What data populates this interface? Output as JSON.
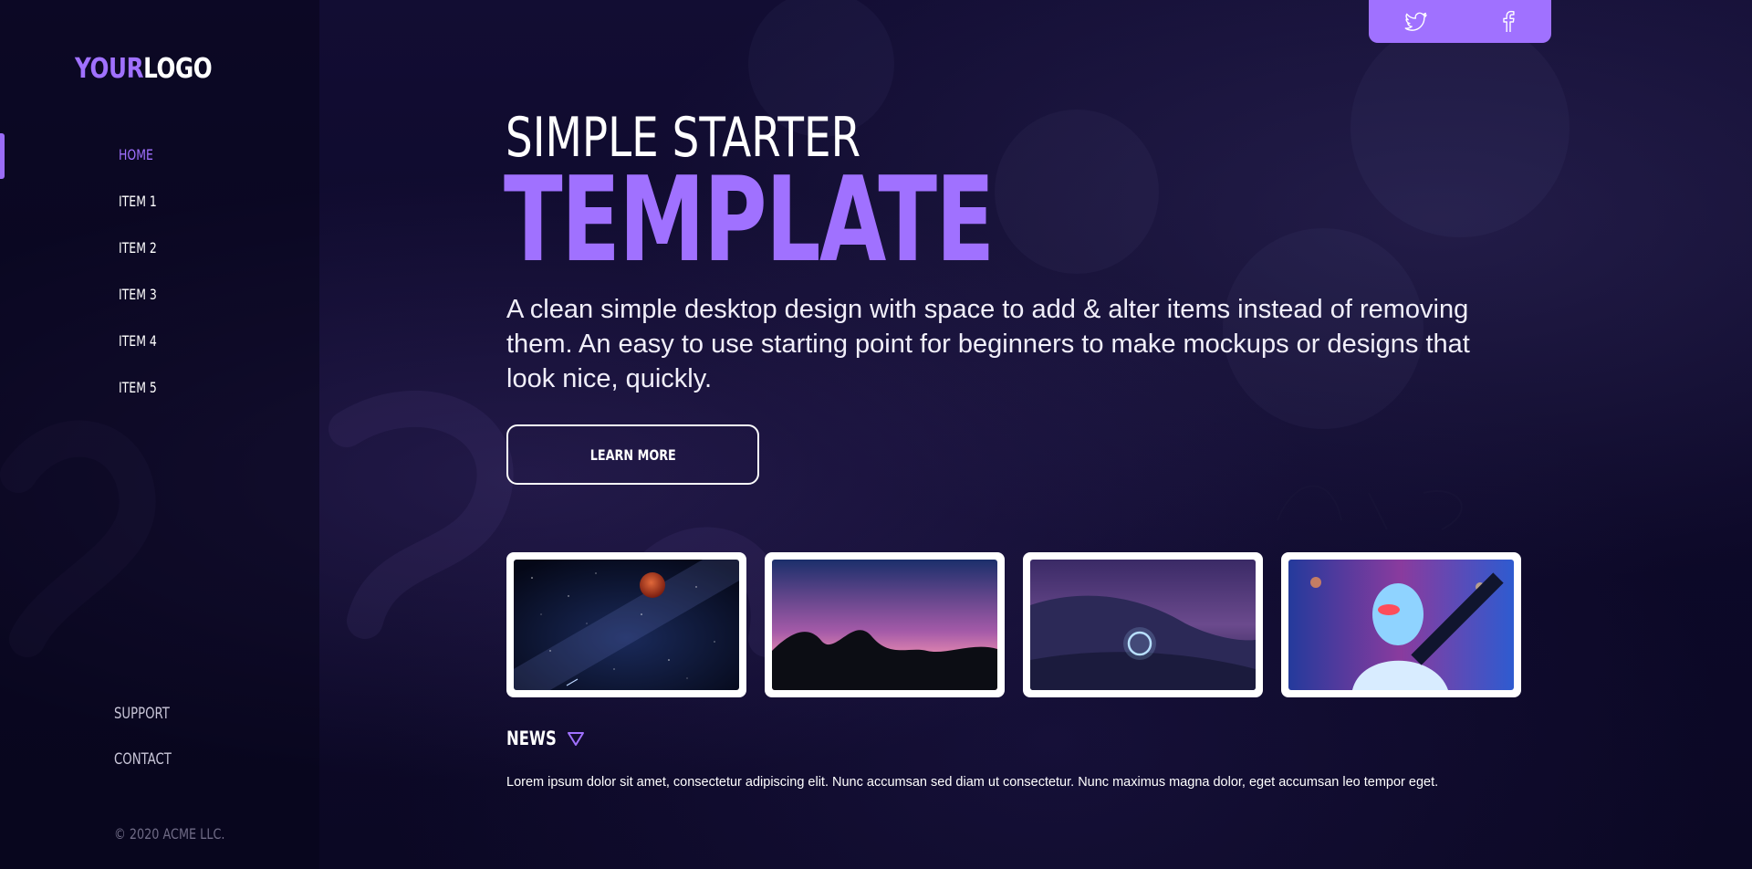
{
  "logo": {
    "part1": "YOUR",
    "part2": "LOGO"
  },
  "nav": {
    "items": [
      "HOME",
      "ITEM 1",
      "ITEM 2",
      "ITEM 3",
      "ITEM 4",
      "ITEM 5"
    ],
    "active": "HOME"
  },
  "footer_nav": {
    "support": "SUPPORT",
    "contact": "CONTACT"
  },
  "copyright": "© 2020 ACME LLC.",
  "social": {
    "icons": [
      "twitter-icon",
      "facebook-icon"
    ]
  },
  "hero": {
    "subtitle": "SIMPLE STARTER",
    "title": "TEMPLATE",
    "description": "A clean simple desktop design with space to add & alter items instead of removing them. An easy to use starting point for beginners to make mockups or designs that look nice, quickly.",
    "button_label": "LEARN MORE"
  },
  "gallery": {
    "images": [
      "blood-moon-starry-sky",
      "desert-rocks-pink-sky",
      "light-painting-snow-night",
      "neon-masked-figure"
    ]
  },
  "news": {
    "label": "NEWS",
    "text": "Lorem ipsum dolor sit amet, consectetur adipiscing elit. Nunc accumsan sed diam ut consectetur. Nunc maximus magna dolor, eget accumsan leo tempor eget."
  },
  "colors": {
    "accent": "#a071ff",
    "background": "#0e0a2b",
    "text": "#ffffff"
  }
}
